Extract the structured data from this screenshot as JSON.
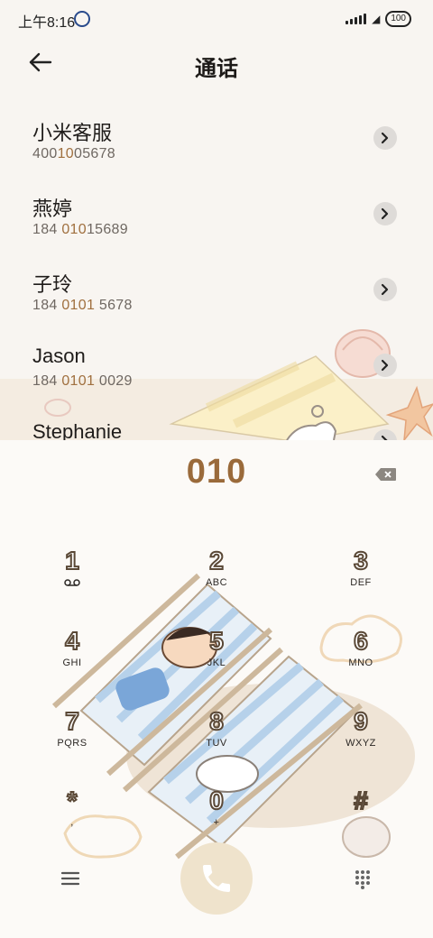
{
  "status_bar": {
    "time": "上午8:16",
    "battery": "100"
  },
  "header": {
    "title": "通话"
  },
  "contacts": [
    {
      "name": "小米客服",
      "number_pre": "400",
      "number_hl": "10",
      "number_post": "05678"
    },
    {
      "name": "燕婷",
      "number_pre": "184 ",
      "number_hl": "010",
      "number_post": "15689"
    },
    {
      "name": "子玲",
      "number_pre": "184 ",
      "number_hl": "0101",
      "number_post": " 5678"
    },
    {
      "name": "Jason",
      "number_pre": "184 ",
      "number_hl": "0101",
      "number_post": " 0029"
    },
    {
      "name": "Stephanie",
      "number_pre": "",
      "number_hl": "",
      "number_post": ""
    }
  ],
  "dialer": {
    "entered_number": "010"
  },
  "keypad": [
    {
      "digit": "1",
      "letters": "voicemail"
    },
    {
      "digit": "2",
      "letters": "ABC"
    },
    {
      "digit": "3",
      "letters": "DEF"
    },
    {
      "digit": "4",
      "letters": "GHI"
    },
    {
      "digit": "5",
      "letters": "JKL"
    },
    {
      "digit": "6",
      "letters": "MNO"
    },
    {
      "digit": "7",
      "letters": "PQRS"
    },
    {
      "digit": "8",
      "letters": "TUV"
    },
    {
      "digit": "9",
      "letters": "WXYZ"
    },
    {
      "digit": "*",
      "letters": ","
    },
    {
      "digit": "0",
      "letters": "+"
    },
    {
      "digit": "#",
      "letters": ""
    }
  ],
  "colors": {
    "accent_number": "#9a6a3a",
    "call_button": "#efe3cc",
    "highlight_digits": "#a0703f"
  }
}
